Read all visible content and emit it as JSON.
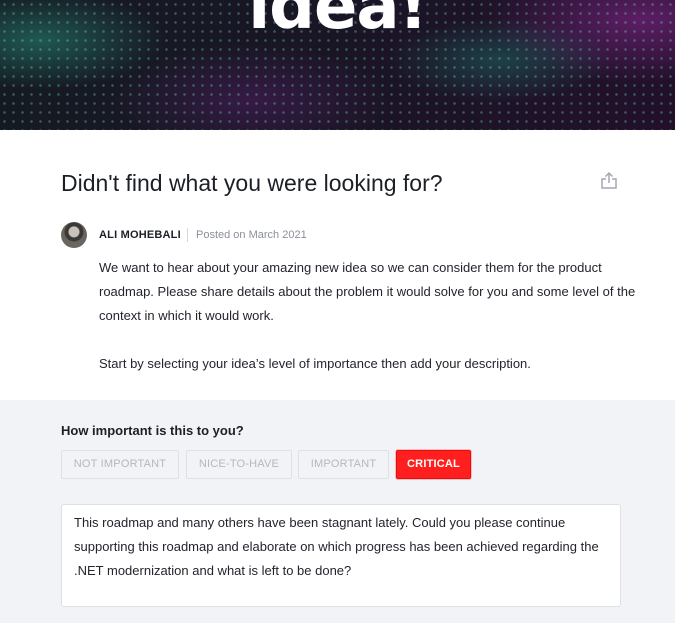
{
  "hero": {
    "title": "idea!"
  },
  "post": {
    "title": "Didn't find what you were looking for?",
    "author": "ALI MOHEBALI",
    "posted": "Posted on March 2021",
    "paragraphs": [
      "We want to hear about your amazing new idea so we can consider them for the product roadmap. Please share details about the problem it would solve for you and some level of the context in which it would work.",
      "Start by selecting your idea’s level of importance then add your description."
    ],
    "share_icon": "share-icon"
  },
  "importance": {
    "label": "How important is this to you?",
    "options": [
      "NOT IMPORTANT",
      "NICE-TO-HAVE",
      "IMPORTANT",
      "CRITICAL"
    ],
    "selected": "CRITICAL",
    "selected_color": "#ff1f1f"
  },
  "description": {
    "value": "This roadmap and many others have been stagnant lately. Could you please continue supporting this roadmap and elaborate on which progress has been achieved regarding the .NET modernization and what is left to be done?"
  }
}
